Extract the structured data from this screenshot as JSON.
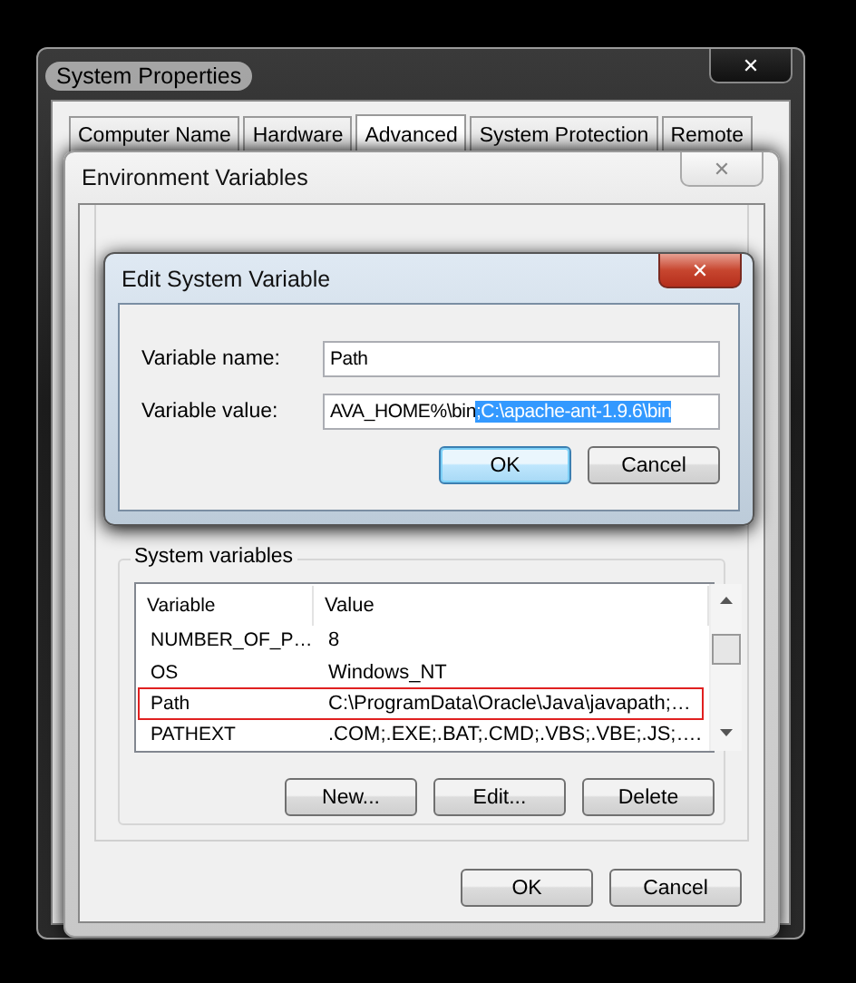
{
  "system_properties": {
    "title": "System Properties",
    "close": "✕",
    "tabs": [
      {
        "label": "Computer Name",
        "selected": false
      },
      {
        "label": "Hardware",
        "selected": false
      },
      {
        "label": "Advanced",
        "selected": true
      },
      {
        "label": "System Protection",
        "selected": false
      },
      {
        "label": "Remote",
        "selected": false
      }
    ]
  },
  "environment_variables": {
    "title": "Environment Variables",
    "close": "✕",
    "system_variables": {
      "label": "System variables",
      "columns": [
        "Variable",
        "Value"
      ],
      "rows": [
        {
          "variable": "NUMBER_OF_P…",
          "value": "8",
          "outlined": false
        },
        {
          "variable": "OS",
          "value": "Windows_NT",
          "outlined": false
        },
        {
          "variable": "Path",
          "value": "C:\\ProgramData\\Oracle\\Java\\javapath;…",
          "outlined": true
        },
        {
          "variable": "PATHEXT",
          "value": ".COM;.EXE;.BAT;.CMD;.VBS;.VBE;.JS;….",
          "outlined": false
        }
      ],
      "buttons": [
        "New...",
        "Edit...",
        "Delete"
      ]
    },
    "buttons": [
      {
        "label": "OK",
        "default": false
      },
      {
        "label": "Cancel",
        "default": false
      }
    ]
  },
  "edit_dialog": {
    "title": "Edit System Variable",
    "close": "✕",
    "fields": [
      {
        "label": "Variable name:",
        "value": "Path"
      },
      {
        "label": "Variable value:",
        "value": "AVA_HOME%\\bin",
        "selected_text": ";C:\\apache-ant-1.9.6\\bin"
      }
    ],
    "buttons": [
      {
        "label": "OK",
        "default": true
      },
      {
        "label": "Cancel",
        "default": false
      }
    ]
  }
}
